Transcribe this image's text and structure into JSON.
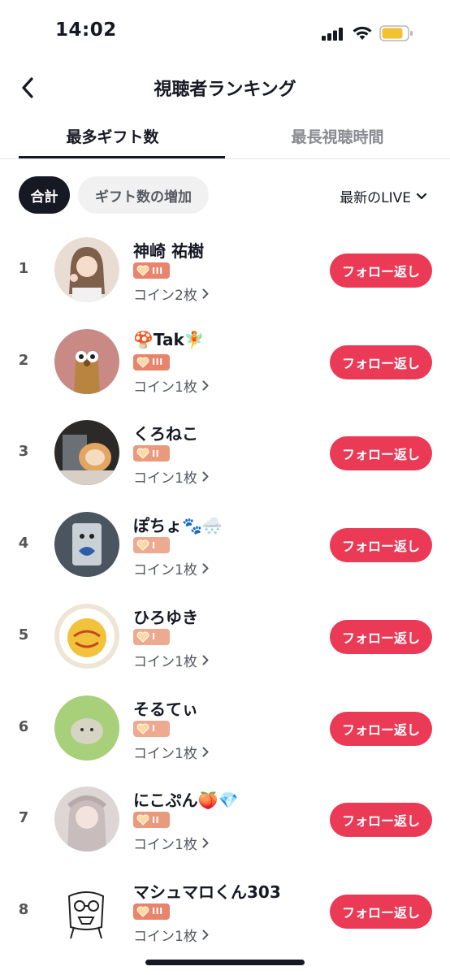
{
  "status": {
    "time": "14:02"
  },
  "nav": {
    "title": "視聴者ランキング"
  },
  "tabs": [
    {
      "label": "最多ギフト数",
      "active": true
    },
    {
      "label": "最長視聴時間",
      "active": false
    }
  ],
  "filters": {
    "chips": [
      "合計",
      "ギフト数の増加"
    ],
    "live_select": "最新のLIVE"
  },
  "follow_label": "フォロー返し",
  "viewers": [
    {
      "rank": "1",
      "name": "神崎 祐樹",
      "level": "III",
      "coins": "コイン2枚"
    },
    {
      "rank": "2",
      "name": "🍄Tak🧚",
      "level": "III",
      "coins": "コイン1枚"
    },
    {
      "rank": "3",
      "name": "くろねこ",
      "level": "II",
      "coins": "コイン1枚"
    },
    {
      "rank": "4",
      "name": "ぽちょ🐾🌨️",
      "level": "I",
      "coins": "コイン1枚"
    },
    {
      "rank": "5",
      "name": "ひろゆき",
      "level": "I",
      "coins": "コイン1枚"
    },
    {
      "rank": "6",
      "name": "そるてぃ",
      "level": "I",
      "coins": "コイン1枚"
    },
    {
      "rank": "7",
      "name": "にこぷん🍑💎",
      "level": "II",
      "coins": "コイン1枚"
    },
    {
      "rank": "8",
      "name": "マシュマロくん303",
      "level": "III",
      "coins": "コイン1枚"
    }
  ],
  "icons": {
    "back": "chevron-left-icon",
    "chevron_down": "chevron-down-icon",
    "chevron_right": "chevron-right-icon",
    "badge": "heart-icon"
  },
  "colors": {
    "follow_button": "#ea3a56",
    "badge": "#e8846b",
    "text_primary": "#161823",
    "text_secondary": "#8a8b91"
  }
}
